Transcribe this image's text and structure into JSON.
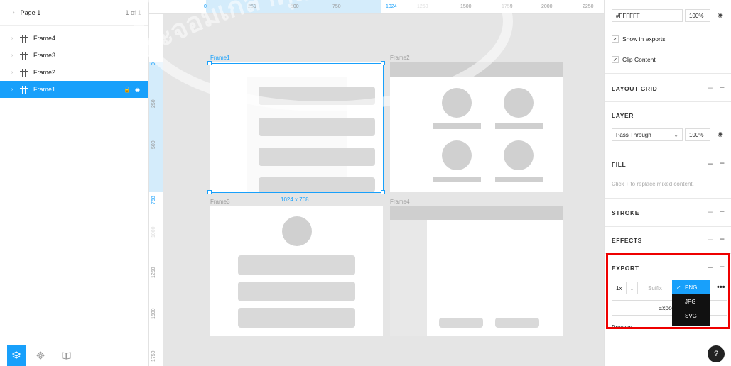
{
  "sidebar": {
    "page_name": "Page 1",
    "page_count": "1 of 1",
    "layers": [
      {
        "label": "Frame4",
        "selected": false
      },
      {
        "label": "Frame3",
        "selected": false
      },
      {
        "label": "Frame2",
        "selected": false
      },
      {
        "label": "Frame1",
        "selected": true
      }
    ],
    "bottom_tabs": [
      "layers-icon",
      "components-icon",
      "library-icon"
    ]
  },
  "ruler_top": {
    "ticks": [
      "0",
      "250",
      "500",
      "750",
      "1024",
      "1250",
      "1500",
      "1750",
      "2000",
      "2250"
    ],
    "highlight_ticks": [
      "0",
      "1024"
    ]
  },
  "ruler_left": {
    "ticks": [
      "0",
      "250",
      "500",
      "768",
      "1000",
      "1250",
      "1500",
      "1750"
    ],
    "highlight_ticks": [
      "0",
      "768"
    ]
  },
  "canvas": {
    "frames": [
      "Frame1",
      "Frame2",
      "Frame3",
      "Frame4"
    ],
    "selection_size": "1024 x 768"
  },
  "watermark": {
    "text": "พระจอมเกล้าคุณทหาร"
  },
  "right_panel": {
    "fill_color": "#FFFFFF",
    "fill_opacity": "100%",
    "show_in_exports": "Show in exports",
    "clip_content": "Clip Content",
    "layout_grid": "LAYOUT GRID",
    "layer_title": "LAYER",
    "blend_mode": "Pass Through",
    "layer_opacity": "100%",
    "fill_title": "FILL",
    "fill_hint": "Click + to replace mixed content.",
    "stroke_title": "STROKE",
    "effects_title": "EFFECTS",
    "export_title": "EXPORT",
    "export_scale": "1x",
    "suffix_placeholder": "Suffix",
    "export_button": "Export F",
    "preview": "Preview"
  },
  "format_dropdown": {
    "options": [
      "PNG",
      "JPG",
      "SVG"
    ],
    "selected": "PNG"
  },
  "help_label": "?",
  "colors": {
    "accent": "#18a0fb",
    "highlight_box": "#e00000"
  }
}
